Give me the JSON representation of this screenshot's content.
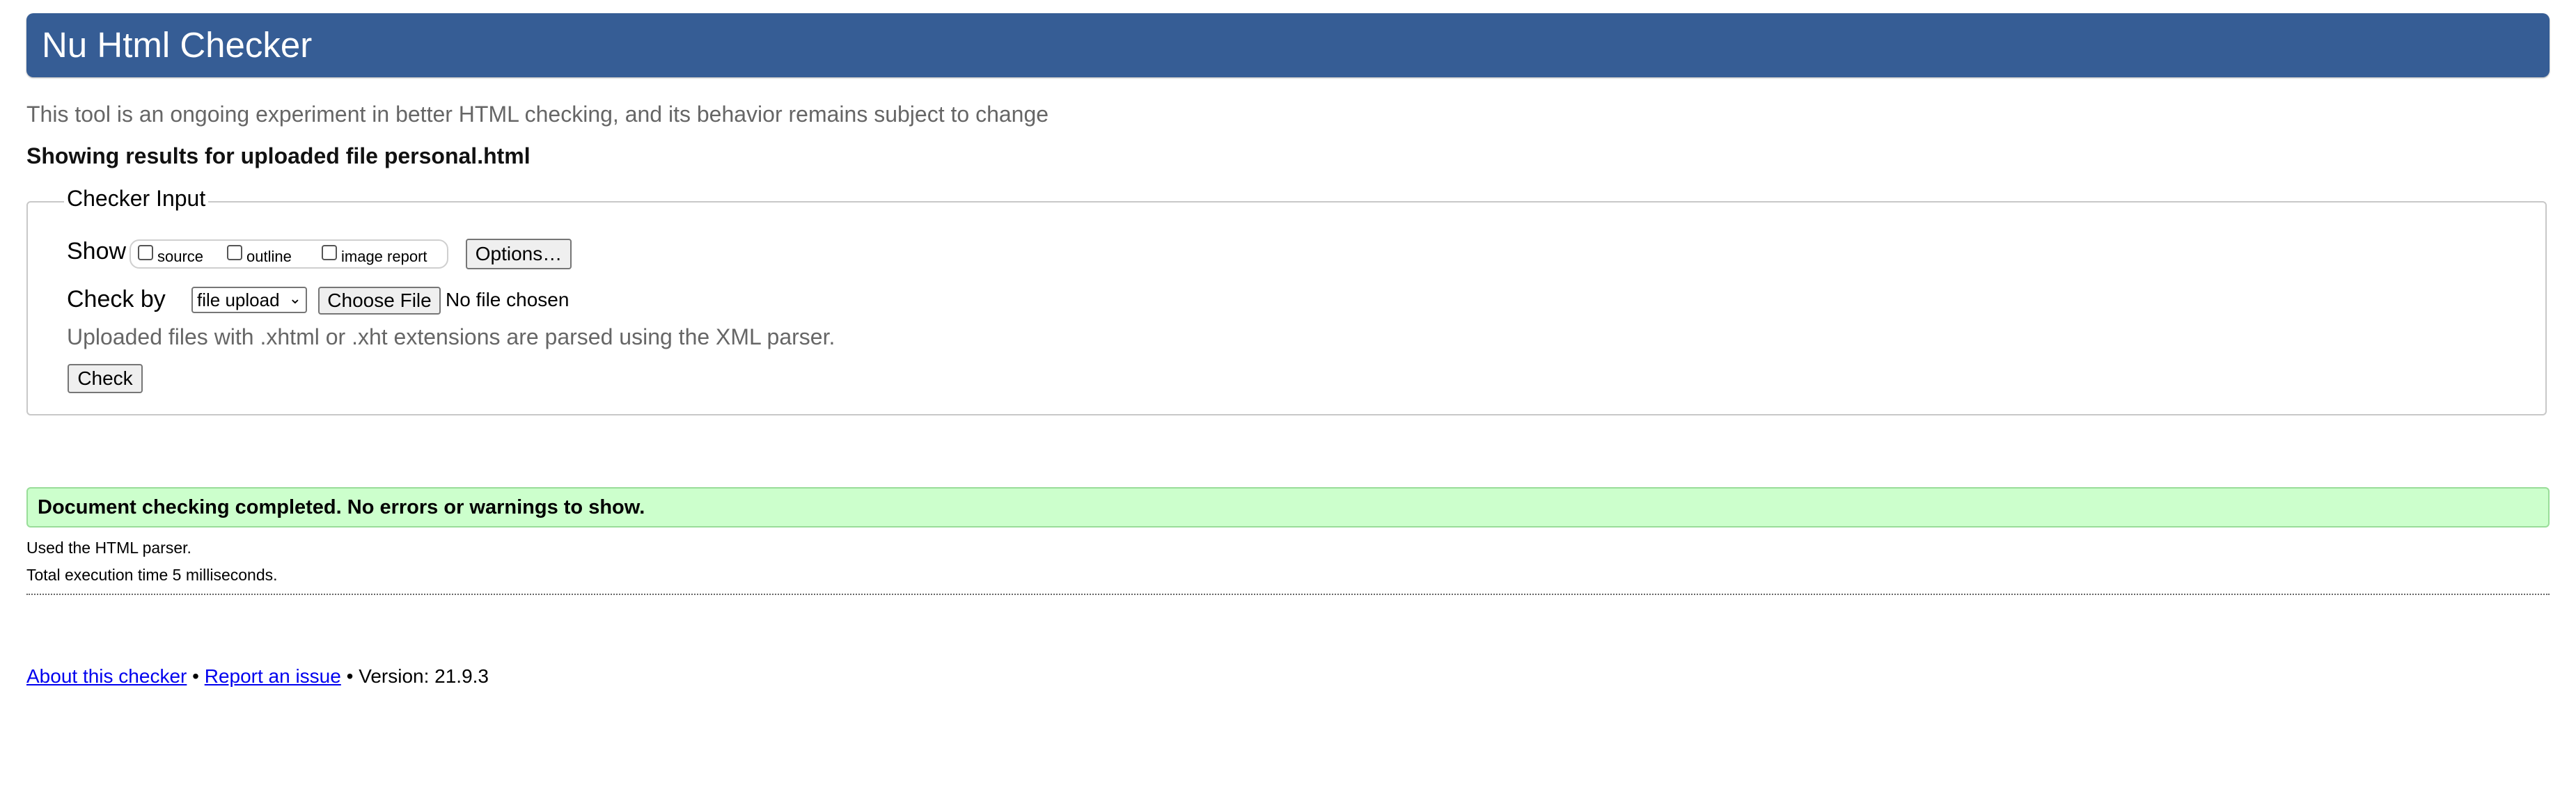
{
  "header": {
    "title": "Nu Html Checker"
  },
  "intro": "This tool is an ongoing experiment in better HTML checking, and its behavior remains subject to change",
  "showing": "Showing results for uploaded file personal.html",
  "checker_input": {
    "legend": "Checker Input",
    "show_label": "Show",
    "show_options": [
      {
        "label": "source",
        "checked": false
      },
      {
        "label": "outline",
        "checked": false
      },
      {
        "label": "image report",
        "checked": false
      }
    ],
    "options_button": "Options…",
    "check_by_label": "Check by",
    "check_by_selected": "file upload",
    "choose_file_button": "Choose File",
    "no_file_text": "No file chosen",
    "xml_note": "Uploaded files with .xhtml or .xht extensions are parsed using the XML parser.",
    "check_button": "Check"
  },
  "result": {
    "success_message": "Document checking completed. No errors or warnings to show.",
    "parser_note": "Used the HTML parser.",
    "execution_time": "Total execution time 5 milliseconds."
  },
  "footer": {
    "about_link": "About this checker",
    "separator": "•",
    "report_link": "Report an issue",
    "version": "Version: 21.9.3"
  },
  "colors": {
    "header_bg": "#365d95",
    "success_bg": "#ccffcc",
    "link": "#0000ee"
  }
}
